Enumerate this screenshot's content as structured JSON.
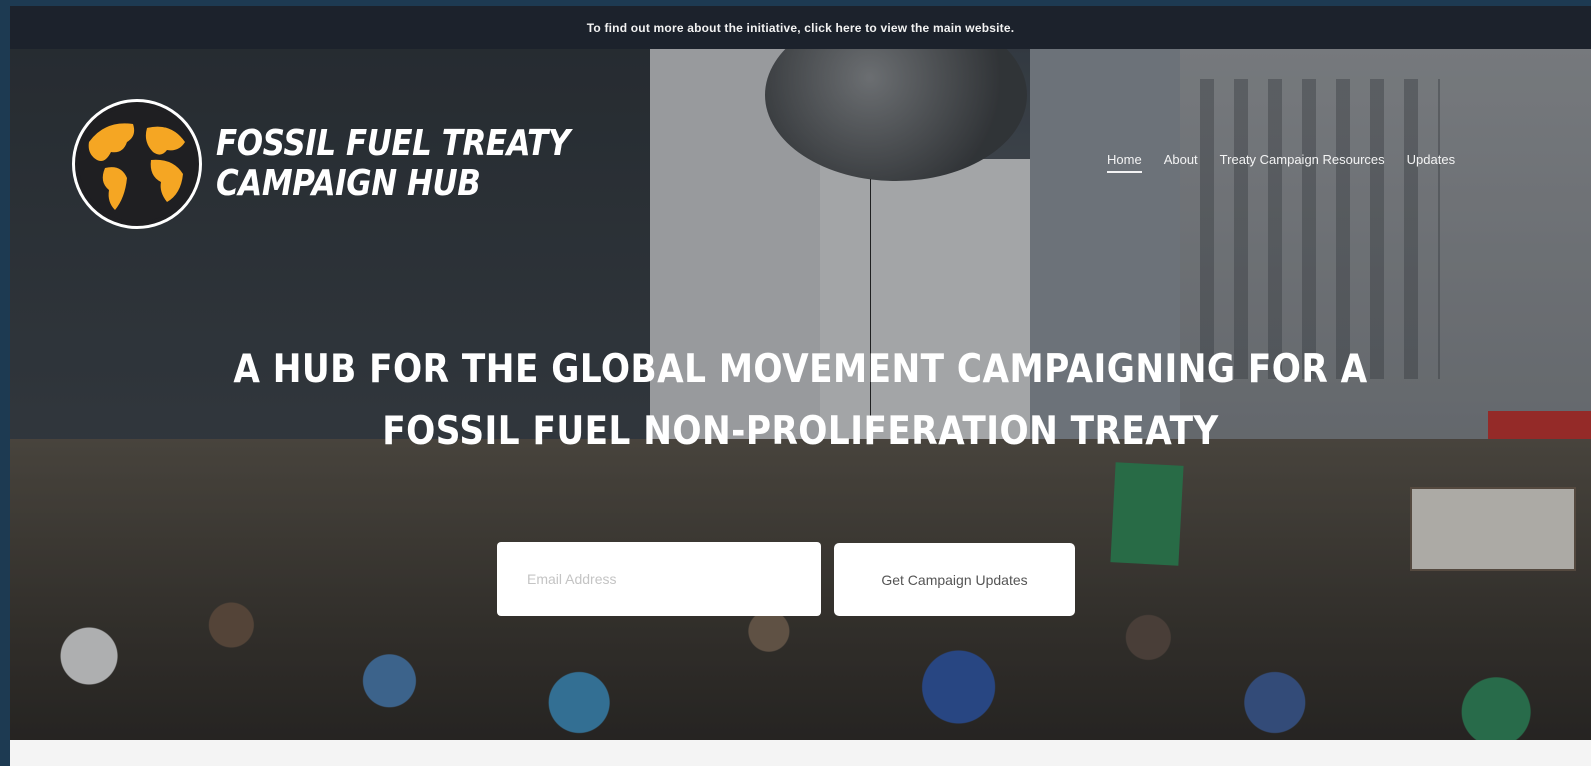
{
  "announcement": {
    "text": "To find out more about the initiative, click here to view the main website."
  },
  "logo": {
    "line1": "FOSSIL FUEL TREATY",
    "line2": "CAMPAIGN HUB",
    "icon": "globe-icon",
    "colors": {
      "continents": "#f5a623",
      "ocean": "#1f1f22",
      "ring": "#ffffff"
    }
  },
  "nav": {
    "items": [
      {
        "label": "Home",
        "active": true
      },
      {
        "label": "About"
      },
      {
        "label": "Treaty Campaign Resources"
      },
      {
        "label": "Updates"
      }
    ]
  },
  "hero": {
    "headline_line1": "A HUB FOR THE GLOBAL MOVEMENT CAMPAIGNING FOR A",
    "headline_line2": "FOSSIL FUEL NON-PROLIFERATION TREATY"
  },
  "signup": {
    "email_placeholder": "Email Address",
    "button_label": "Get Campaign Updates"
  },
  "colors": {
    "announcement_bg": "#1c222c",
    "page_border": "#1d3a52",
    "accent": "#f5a623"
  }
}
